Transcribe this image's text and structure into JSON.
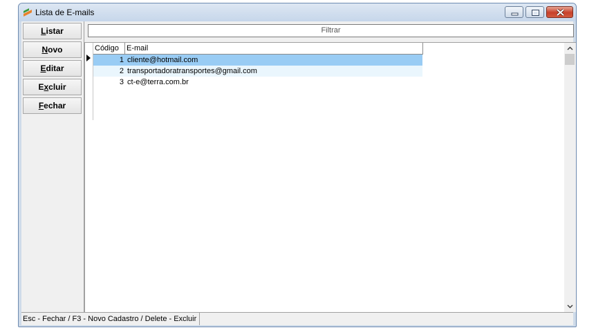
{
  "window": {
    "title": "Lista de E-mails",
    "controls": {
      "minimize": "minimize",
      "maximize": "maximize",
      "close": "close"
    }
  },
  "sidebar": {
    "buttons": [
      {
        "label_hot": "L",
        "label_rest": "istar"
      },
      {
        "label_hot": "N",
        "label_rest": "ovo"
      },
      {
        "label_hot": "E",
        "label_rest": "ditar"
      },
      {
        "label_pre": "E",
        "label_hot": "x",
        "label_rest": "cluir"
      },
      {
        "label_hot": "F",
        "label_rest": "echar"
      }
    ]
  },
  "filter": {
    "label": "Filtrar"
  },
  "grid": {
    "columns": [
      "Código",
      "E-mail"
    ],
    "rows": [
      {
        "code": "1",
        "email": "cliente@hotmail.com"
      },
      {
        "code": "2",
        "email": "transportadoratransportes@gmail.com"
      },
      {
        "code": "3",
        "email": "ct-e@terra.com.br"
      }
    ]
  },
  "statusbar": {
    "text": "Esc - Fechar / F3 - Novo Cadastro / Delete - Excluir"
  },
  "colors": {
    "selected_row": "#99ccf4",
    "alt_row": "#eaf6fd",
    "close_button": "#c7402a"
  }
}
